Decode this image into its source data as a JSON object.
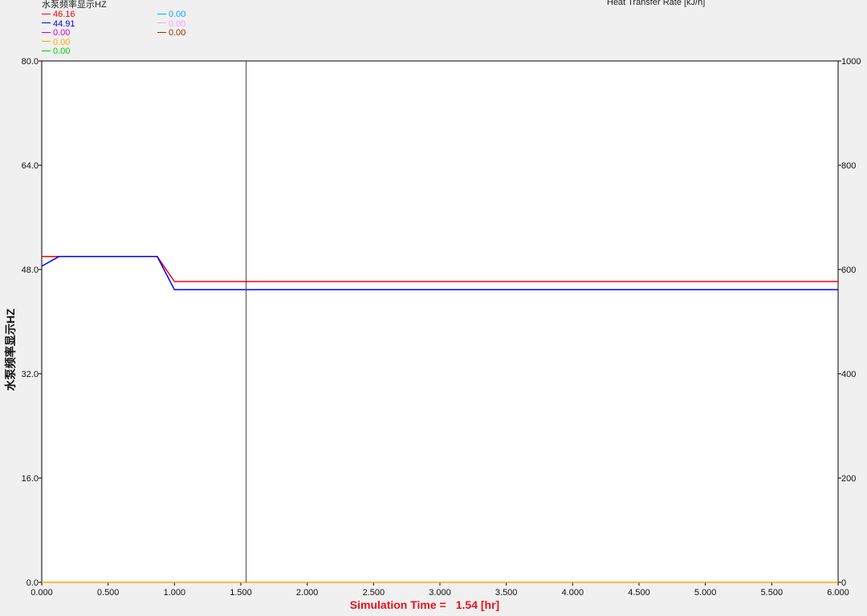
{
  "header": {
    "left_axis_title": "水泵频率显示HZ",
    "right_axis_title": "Heat Transfer Rate [kJ/h]"
  },
  "legend": {
    "left_column": [
      {
        "value": "46.16",
        "color": "#ff0000"
      },
      {
        "value": "44.91",
        "color": "#0000ff"
      },
      {
        "value": "0.00",
        "color": "#cc00cc"
      },
      {
        "value": "0.00",
        "color": "#ffa500"
      },
      {
        "value": "0.00",
        "color": "#00cc00"
      }
    ],
    "right_column": [
      {
        "value": "0.00",
        "color": "#00aaff"
      },
      {
        "value": "0.00",
        "color": "#ff99ff"
      },
      {
        "value": "0.00",
        "color": "#993300"
      }
    ]
  },
  "footer": {
    "simulation_time_label": "Simulation Time =",
    "simulation_time_value": "1.54 [hr]"
  },
  "chart_data": {
    "type": "line",
    "ylabel": "水泵频率显示HZ",
    "ylabel_right": "Heat Transfer Rate [kJ/h]",
    "xlim": [
      0,
      6
    ],
    "ylim": [
      0,
      80
    ],
    "ylim_right": [
      0,
      1000
    ],
    "x_tick_labels": [
      "0.000",
      "0.500",
      "1.000",
      "1.500",
      "2.000",
      "2.500",
      "3.000",
      "3.500",
      "4.000",
      "4.500",
      "5.000",
      "5.500",
      "6.000"
    ],
    "y_tick_labels": [
      "0.0",
      "16.0",
      "32.0",
      "48.0",
      "64.0",
      "80.0"
    ],
    "y_right_tick_labels": [
      "0",
      "200",
      "400",
      "600",
      "800",
      "1000"
    ],
    "cursor_x": 1.54,
    "grid": false,
    "series": [
      {
        "color": "#ff0000",
        "points": [
          [
            0,
            50
          ],
          [
            0.13,
            50
          ],
          [
            0.87,
            50
          ],
          [
            1.0,
            46.16
          ],
          [
            6.0,
            46.16
          ]
        ]
      },
      {
        "color": "#0000ff",
        "points": [
          [
            0,
            48.5
          ],
          [
            0.13,
            50
          ],
          [
            0.87,
            50
          ],
          [
            1.0,
            44.91
          ],
          [
            6.0,
            44.91
          ]
        ]
      },
      {
        "color": "#ffa500",
        "points": [
          [
            0,
            0
          ],
          [
            6.0,
            0
          ]
        ]
      }
    ]
  }
}
